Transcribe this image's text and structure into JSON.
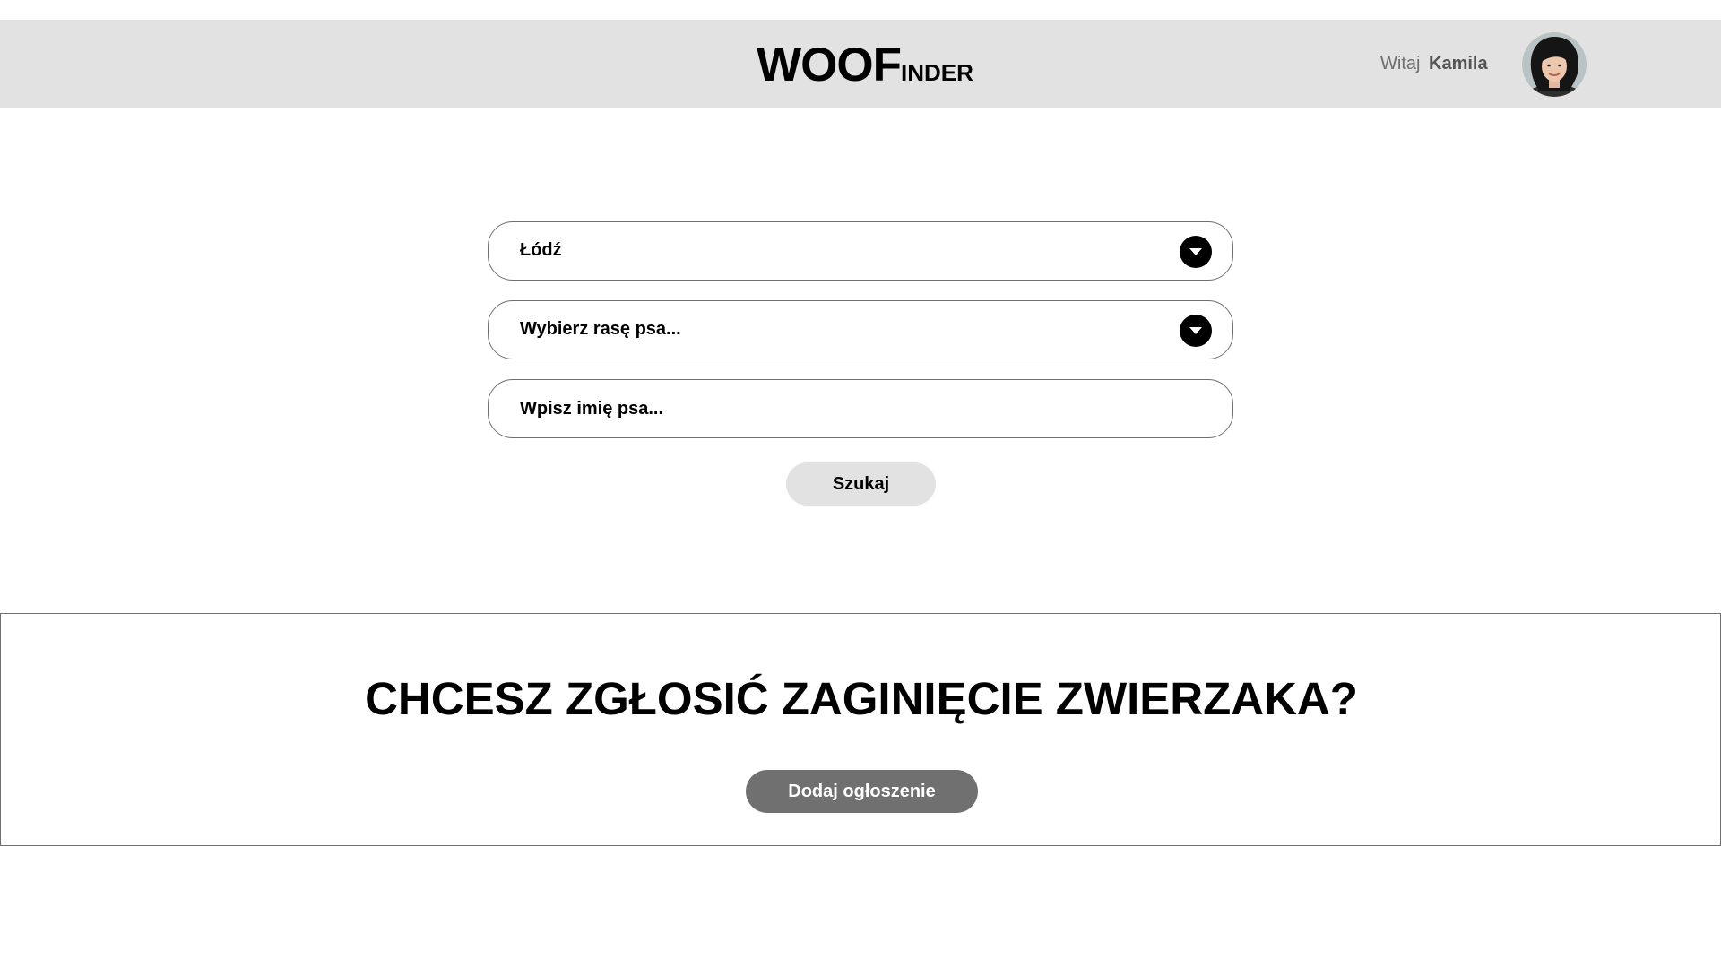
{
  "header": {
    "logo_big": "WOOF",
    "logo_small": "INDER",
    "greeting_prefix": "Witaj",
    "user_name": "Kamila",
    "avatar_icon": "user-avatar-photo"
  },
  "search": {
    "city_value": "Łódź",
    "breed_placeholder": "Wybierz rasę psa...",
    "name_placeholder": "Wpisz imię psa...",
    "dropdown_icon": "chevron-down-icon",
    "button_label": "Szukaj"
  },
  "report": {
    "title": "CHCESZ ZGŁOSIĆ ZAGINIĘCIE ZWIERZAKA?",
    "button_label": "Dodaj ogłoszenie"
  },
  "colors": {
    "header_bg": "#e2e2e2",
    "search_button_bg": "#e2e2e2",
    "add_button_bg": "#707070",
    "border": "#707070"
  }
}
